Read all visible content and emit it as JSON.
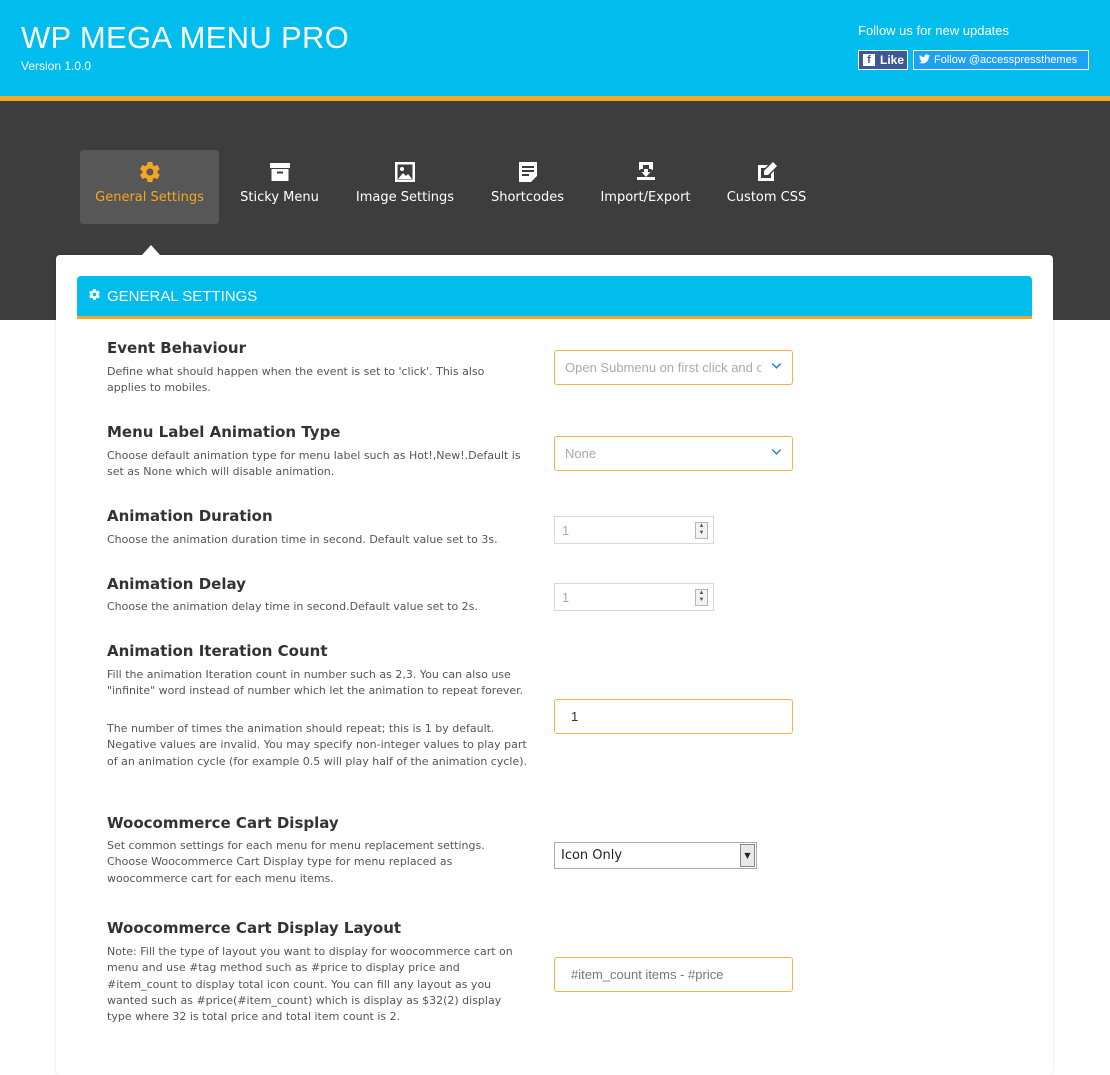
{
  "header": {
    "title": "WP MEGA MENU PRO",
    "version": "Version 1.0.0",
    "follow_text": "Follow us for new updates",
    "facebook_label": "Like",
    "twitter_label": "Follow @accesspressthemes"
  },
  "tabs": [
    {
      "label": "General Settings",
      "icon": "gear-icon",
      "active": true
    },
    {
      "label": "Sticky Menu",
      "icon": "archive-icon",
      "active": false
    },
    {
      "label": "Image Settings",
      "icon": "image-icon",
      "active": false
    },
    {
      "label": "Shortcodes",
      "icon": "document-icon",
      "active": false
    },
    {
      "label": "Import/Export",
      "icon": "download-icon",
      "active": false
    },
    {
      "label": "Custom CSS",
      "icon": "edit-icon",
      "active": false
    }
  ],
  "panel": {
    "title": "GENERAL SETTINGS"
  },
  "settings": {
    "event_behaviour": {
      "title": "Event Behaviour",
      "desc": "Define what should happen when the event is set to 'click'. This also applies to mobiles.",
      "value": "Open Submenu on first click and close on second click"
    },
    "label_animation": {
      "title": "Menu Label Animation Type",
      "desc": "Choose default animation type for menu label such as Hot!,New!.Default is set as None which will disable animation.",
      "value": "None"
    },
    "animation_duration": {
      "title": "Animation Duration",
      "desc": "Choose the animation duration time in second. Default value set to 3s.",
      "value": "1"
    },
    "animation_delay": {
      "title": "Animation Delay",
      "desc": "Choose the animation delay time in second.Default value set to 2s.",
      "value": "1"
    },
    "iteration_count": {
      "title": "Animation Iteration Count",
      "desc1": "Fill the animation Iteration count in number such as 2,3. You can also use \"infinite\" word instead of number which let the animation to repeat forever.",
      "desc2": "The number of times the animation should repeat; this is 1 by default. Negative values are invalid. You may specify non-integer values to play part of an animation cycle (for example 0.5 will play half of the animation cycle).",
      "value": "1"
    },
    "cart_display": {
      "title": "Woocommerce Cart Display",
      "desc": "Set common settings for each menu for menu replacement settings. Choose Woocommerce Cart Display type for menu replaced as woocommerce cart for each menu items.",
      "value": "Icon Only"
    },
    "cart_layout": {
      "title": "Woocommerce Cart Display Layout",
      "desc": "Note: Fill the type of layout you want to display for woocommerce cart on menu and use #tag method such as #price to display price and #item_count to display total icon count. You can fill any layout as you wanted such as #price(#item_count) which is display as $32(2) display type where 32 is total price and total item count is 2.",
      "value": "#item_count items -  #price"
    }
  },
  "colors": {
    "brand": "#00bdee",
    "accent": "#f5a623",
    "dark": "#3d3d3d"
  }
}
